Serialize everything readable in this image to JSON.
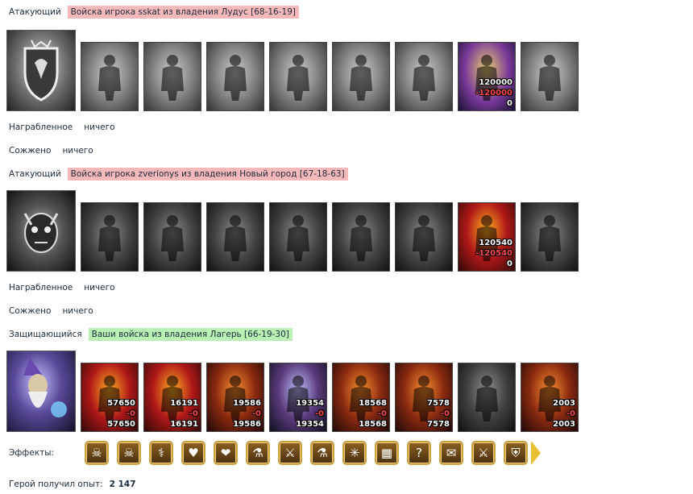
{
  "sections": [
    {
      "role": "Атакующий",
      "banner": "Войска игрока sskat из владения Лудус [68-16-19]",
      "banner_color": "#f6b9b9",
      "hero_icon": "lion-shield-crest-icon",
      "units": [
        {
          "icon": "boar-rider-icon",
          "style": "gray"
        },
        {
          "icon": "knight-icon",
          "style": "gray"
        },
        {
          "icon": "mounted-knight-icon",
          "style": "gray"
        },
        {
          "icon": "griffin-icon",
          "style": "gray"
        },
        {
          "icon": "crossbowman-icon",
          "style": "gray"
        },
        {
          "icon": "monk-icon",
          "style": "gray"
        },
        {
          "icon": "swordsman-icon",
          "style": "color-a",
          "count": "120000",
          "lost": "120000",
          "remaining": "0"
        },
        {
          "icon": "reaper-icon",
          "style": "gray"
        }
      ],
      "loot_label": "Награбленное",
      "loot_value": "ничего",
      "burned_label": "Сожжено",
      "burned_value": "ничего"
    },
    {
      "role": "Атакующий",
      "banner": "Войска игрока zverionys из владения Новый город [67-18-63]",
      "banner_color": "#f6b9b9",
      "hero_icon": "demon-skull-crest-icon",
      "units": [
        {
          "icon": "hellhound-icon",
          "style": "dark"
        },
        {
          "icon": "skeleton-icon",
          "style": "dark"
        },
        {
          "icon": "fire-beast-icon",
          "style": "dark"
        },
        {
          "icon": "winged-demon-icon",
          "style": "dark"
        },
        {
          "icon": "pit-fiend-icon",
          "style": "dark"
        },
        {
          "icon": "warrior-icon",
          "style": "dark"
        },
        {
          "icon": "archdevil-icon",
          "style": "color-b",
          "count": "120540",
          "lost": "120540",
          "remaining": "0"
        },
        {
          "icon": "wraith-icon",
          "style": "dark"
        }
      ],
      "loot_label": "Награбленное",
      "loot_value": "ничего",
      "burned_label": "Сожжено",
      "burned_value": "ничего"
    },
    {
      "role": "Защищающийся",
      "banner": "Ваши войска из владения Лагерь [66-19-30]",
      "banner_color": "#b9f0b4",
      "hero_icon": "wizard-portrait-icon",
      "units": [
        {
          "icon": "red-drake-icon",
          "style": "color-b",
          "count": "57650",
          "lost": "0",
          "remaining": "57650"
        },
        {
          "icon": "fire-skeleton-icon",
          "style": "color-b",
          "count": "16191",
          "lost": "0",
          "remaining": "16191"
        },
        {
          "icon": "fire-hound-icon",
          "style": "color-c",
          "count": "19586",
          "lost": "0",
          "remaining": "19586"
        },
        {
          "icon": "winged-fiend-icon",
          "style": "color-d",
          "count": "19354",
          "lost": "0",
          "remaining": "19354"
        },
        {
          "icon": "lava-giant-icon",
          "style": "color-c",
          "count": "18568",
          "lost": "0",
          "remaining": "18568"
        },
        {
          "icon": "fire-warrior-icon",
          "style": "color-c",
          "count": "7578",
          "lost": "0",
          "remaining": "7578"
        },
        {
          "icon": "horned-demon-icon",
          "style": "color-e"
        },
        {
          "icon": "flame-wraith-icon",
          "style": "color-c",
          "count": "2003",
          "lost": "0",
          "remaining": "2003"
        }
      ]
    }
  ],
  "effects": {
    "label": "Эффекты:",
    "icons": [
      {
        "icon": "scroll-skull-icon",
        "glyph": "☠"
      },
      {
        "icon": "scroll-skull-2-icon",
        "glyph": "☠"
      },
      {
        "icon": "green-staff-icon",
        "glyph": "⚕"
      },
      {
        "icon": "heart-icon",
        "glyph": "♥"
      },
      {
        "icon": "heart-arrow-icon",
        "glyph": "❤"
      },
      {
        "icon": "green-potion-icon",
        "glyph": "⚗"
      },
      {
        "icon": "sword-icon",
        "glyph": "⚔"
      },
      {
        "icon": "red-potion-icon",
        "glyph": "⚗"
      },
      {
        "icon": "web-icon",
        "glyph": "✳"
      },
      {
        "icon": "armor-icon",
        "glyph": "▦"
      },
      {
        "icon": "question-icon",
        "glyph": "?"
      },
      {
        "icon": "scroll-icon",
        "glyph": "✉"
      },
      {
        "icon": "scimitar-icon",
        "glyph": "⚔"
      },
      {
        "icon": "shield-icon",
        "glyph": "⛨"
      }
    ]
  },
  "experience": {
    "label": "Герой получил опыт:",
    "value": "2 147"
  }
}
